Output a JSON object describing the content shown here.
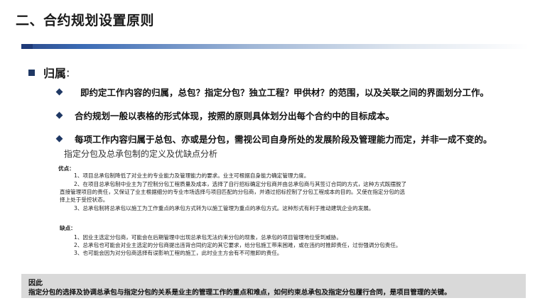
{
  "title": "二、合约规划设置原则",
  "section": {
    "label": "归属",
    "colon": ":"
  },
  "bullets": [
    "即约定工作内容的归属，总包？指定分包？独立工程？甲供材？的范围，以及关联之间的界面划分工作。",
    "合约规划一般以表格的形式体现，按照的原则具体划分出每个合约中的目标成本。",
    "每项工作内容归属于总包、亦或是分包，需视公司自身所处的发展阶段及管理能力而定，并非一成不变的。"
  ],
  "subtitle": "指定分包及总承包制的定义及优缺点分析",
  "advantages": {
    "label": "优点：",
    "items": [
      "1、项目总承包制降低了对业主的专业能力及管理能力的要求。业主可根据自身能力确定管理力度。",
      "2、在项目总承包制中业主为了控制分包工程质量及成本，选择了自行招标确定分包商并由总承包商与其签订合同的方式，这种方式既摆脱了",
      "直接管理项目的责任，又保证了业主根据细分的专业市场选择与项目匹配的分包商，并通过招标控制了分包工程成本的目的。又使在指定分包的选",
      "择上处于受控状态。",
      "3、总承包制将总承包以施工为工作重点的承包方式转为以施工管理为重点的承包方式。这种形式有利于推动建筑企业的发展。"
    ]
  },
  "disadvantages": {
    "label": "缺点：",
    "items": [
      "1、因业主选定分包商，可能会在后期管理中出现总承包无法约束分包的现象，总承包的项目管理地位受到威胁。",
      "2、总承包也可能会对业主选定的分包商提出违背合同约定的其它要求，给分包施工带来困难，或在违约时推卸责任，过份强调分包责任。",
      "3、也可能会因为对分包商选择有误影响工程的施工，此时业主方会有不可推卸的责任。"
    ]
  },
  "conclusion": {
    "label": "因此",
    "text": "指定分包的选择及协调总承包与指定分包的关系是业主的管理工作的重点和难点，如何约束总承包及指定分包履行合同，是项目管理的关键。"
  }
}
